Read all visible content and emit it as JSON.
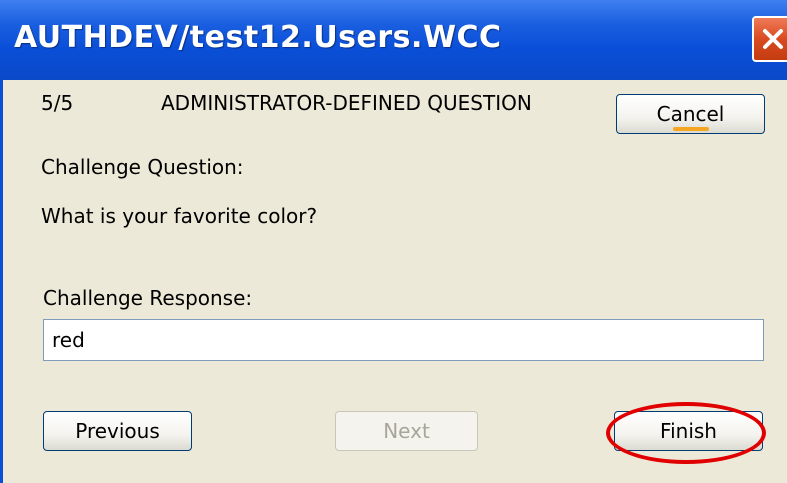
{
  "window": {
    "title": "AUTHDEV/test12.Users.WCC",
    "close_icon": "close-icon"
  },
  "dialog": {
    "step": "5/5",
    "heading": "ADMINISTRATOR-DEFINED QUESTION",
    "cancel_label": "Cancel",
    "question_label": "Challenge Question:",
    "question_text": "What is your favorite color?",
    "response_label": "Challenge Response:",
    "response_value": "red",
    "previous_label": "Previous",
    "next_label": "Next",
    "finish_label": "Finish"
  },
  "colors": {
    "titlebar": "#0a4fd8",
    "client_bg": "#ece9d8",
    "close_button": "#d94b20",
    "highlight": "#e00000"
  }
}
